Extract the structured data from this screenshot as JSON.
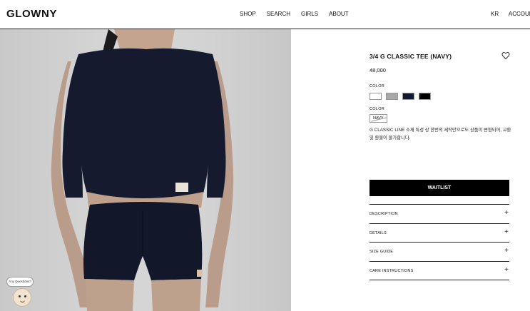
{
  "header": {
    "logo": "GLOWNY",
    "nav": [
      "SHOP",
      "SEARCH",
      "GIRLS",
      "ABOUT"
    ],
    "right": [
      "KR",
      "ACCOUNT"
    ]
  },
  "product": {
    "title": "3/4 G CLASSIC TEE (NAVY)",
    "price": "48,000",
    "color_label": "COLOR",
    "swatches": [
      {
        "name": "white",
        "color": "#ffffff"
      },
      {
        "name": "gray",
        "color": "#a8a8a8"
      },
      {
        "name": "navy",
        "color": "#0f1a33"
      },
      {
        "name": "black",
        "color": "#000000"
      }
    ],
    "selected_color_label": "COLOR",
    "selected_color": "NAVY",
    "description": "G CLASSIC LINE 소재 특성 상 한번의 세탁만으로도 상품이 변형되어, 교환 및 환불이 불가합니다.",
    "waitlist_label": "WAITLIST",
    "accordion": [
      "DESCRIPTION",
      "DETAILS",
      "SIZE GUIDE",
      "CARE INSTRUCTIONS"
    ],
    "accordion_icon": "+"
  },
  "chat": {
    "bubble_text": "Any Questions?"
  }
}
